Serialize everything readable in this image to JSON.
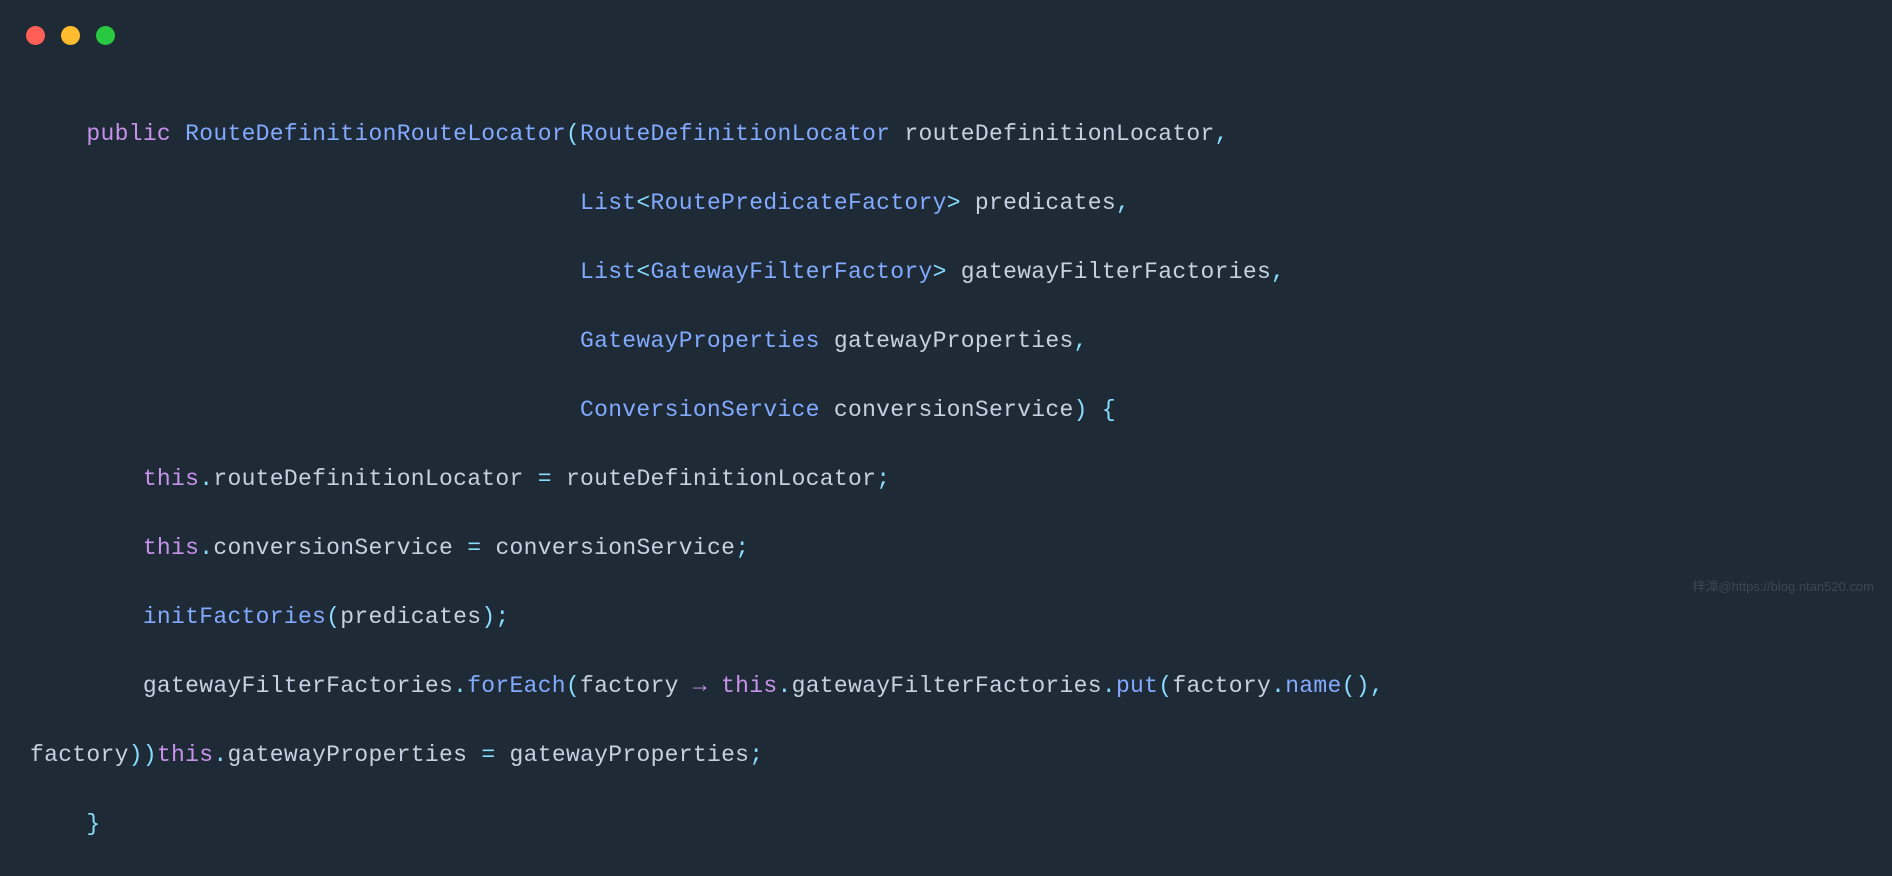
{
  "code": {
    "keyword_public": "public",
    "constructor_name": "RouteDefinitionRouteLocator",
    "param1_type": "RouteDefinitionLocator",
    "param1_name": "routeDefinitionLocator",
    "param2_type_outer": "List",
    "param2_type_inner": "RoutePredicateFactory",
    "param2_name": "predicates",
    "param3_type_outer": "List",
    "param3_type_inner": "GatewayFilterFactory",
    "param3_name": "gatewayFilterFactories",
    "param4_type": "GatewayProperties",
    "param4_name": "gatewayProperties",
    "param5_type": "ConversionService",
    "param5_name": "conversionService",
    "this": "this",
    "field1": "routeDefinitionLocator",
    "assign1_rhs": "routeDefinitionLocator",
    "field2": "conversionService",
    "assign2_rhs": "conversionService",
    "call_init": "initFactories",
    "call_init_arg": "predicates",
    "call_foreach_target": "gatewayFilterFactories",
    "call_foreach": "forEach",
    "lambda_param": "factory",
    "arrow": "→",
    "lambda_field": "gatewayFilterFactories",
    "lambda_put": "put",
    "lambda_arg1": "factory",
    "lambda_name": "name",
    "wrap_arg": "factory",
    "field3": "gatewayProperties",
    "assign3_rhs": "gatewayProperties",
    "indent1": "    ",
    "indent2": "        ",
    "indent_param": "                                       "
  },
  "watermark": "梓漳@https://blog.ntan520.com"
}
